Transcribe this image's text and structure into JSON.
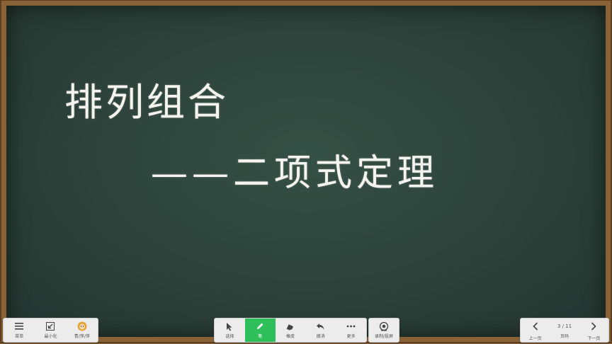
{
  "board": {
    "title": "排列组合",
    "subtitle": "——二项式定理"
  },
  "toolbar_left": {
    "items": [
      {
        "label": "菜单",
        "icon": "menu-icon"
      },
      {
        "label": "最小化",
        "icon": "minimize-icon"
      },
      {
        "label": "青/萍/萍",
        "icon": "avatar-icon"
      }
    ]
  },
  "toolbar_mid": {
    "items": [
      {
        "label": "选择",
        "icon": "cursor-icon"
      },
      {
        "label": "笔",
        "icon": "pen-icon"
      },
      {
        "label": "橡皮",
        "icon": "eraser-icon"
      },
      {
        "label": "撤消",
        "icon": "undo-icon"
      },
      {
        "label": "更多",
        "icon": "more-icon"
      }
    ],
    "active_color": "#2fbf5a"
  },
  "toolbar_record": {
    "label": "录制/投屏",
    "icon": "record-icon"
  },
  "pager": {
    "prev_label": "上一页",
    "count": "3 / 11",
    "count_label": "页码",
    "next_label": "下一页"
  }
}
